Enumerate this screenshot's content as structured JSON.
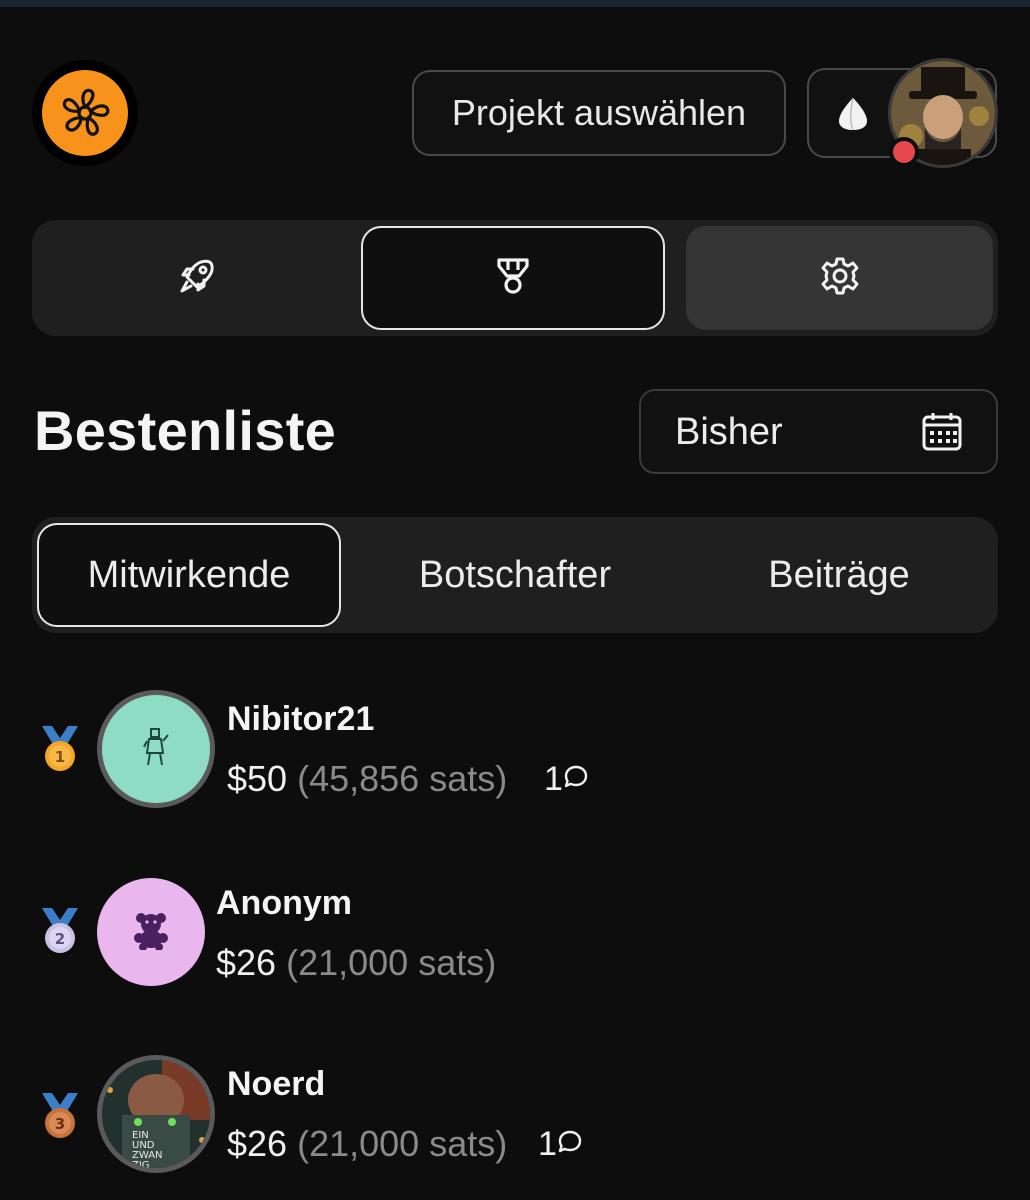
{
  "header": {
    "project_button": "Projekt auswählen",
    "logo_icon": "geyser-logo-icon",
    "user_icon": "nostr-icon",
    "has_notification": true
  },
  "nav_tabs": [
    {
      "icon": "rocket-icon",
      "selected": false
    },
    {
      "icon": "medal-icon",
      "selected": true
    },
    {
      "icon": "gear-icon",
      "selected": false
    }
  ],
  "leaderboard": {
    "title": "Bestenliste",
    "period_label": "Bisher",
    "period_icon": "calendar-icon",
    "subtabs": [
      "Mitwirkende",
      "Botschafter",
      "Beiträge"
    ],
    "selected_subtab": "Mitwirkende",
    "entries": [
      {
        "rank": "1",
        "name": "Nibitor21",
        "amount": "$50",
        "sats": "(45,856 sats)",
        "comments": "1"
      },
      {
        "rank": "2",
        "name": "Anonym",
        "amount": "$26",
        "sats": "(21,000 sats)",
        "comments": ""
      },
      {
        "rank": "3",
        "name": "Noerd",
        "amount": "$26",
        "sats": "(21,000 sats)",
        "comments": "1",
        "avatar_text": "EIN UND ZWAN ZIG"
      }
    ]
  },
  "colors": {
    "background": "#0d0d0d",
    "brand_orange": "#f7931a",
    "notification_red": "#e5484d",
    "gold": "#f5a623",
    "silver": "#c9c1e6",
    "bronze": "#c8733a",
    "medal_ribbon": "#3d7ec9"
  }
}
